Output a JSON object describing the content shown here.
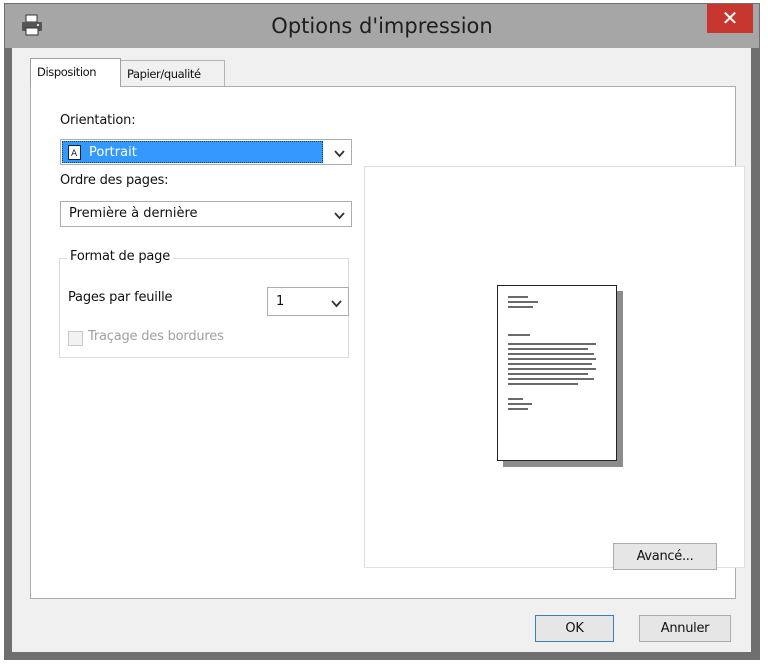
{
  "window": {
    "title": "Options d'impression",
    "close_glyph": "✕",
    "icons": {
      "app": "printer-icon",
      "close": "close-icon"
    }
  },
  "tabs": [
    {
      "label": "Disposition",
      "selected": true
    },
    {
      "label": "Papier/qualité",
      "selected": false
    }
  ],
  "orientation": {
    "label": "Orientation:",
    "value": "Portrait",
    "icon": "portrait-page-icon"
  },
  "page_order": {
    "label": "Ordre des pages:",
    "value": "Première à dernière"
  },
  "page_format": {
    "group_title": "Format de page",
    "pages_per_sheet_label": "Pages par feuille",
    "pages_per_sheet_value": "1",
    "borders_label": "Traçage des bordures",
    "borders_checked": false,
    "borders_enabled": false
  },
  "buttons": {
    "advanced": "Avancé...",
    "ok": "OK",
    "cancel": "Annuler"
  },
  "colors": {
    "title_bar": "#a6a6a6",
    "close_button": "#c7372f",
    "selection": "#3399ff"
  }
}
